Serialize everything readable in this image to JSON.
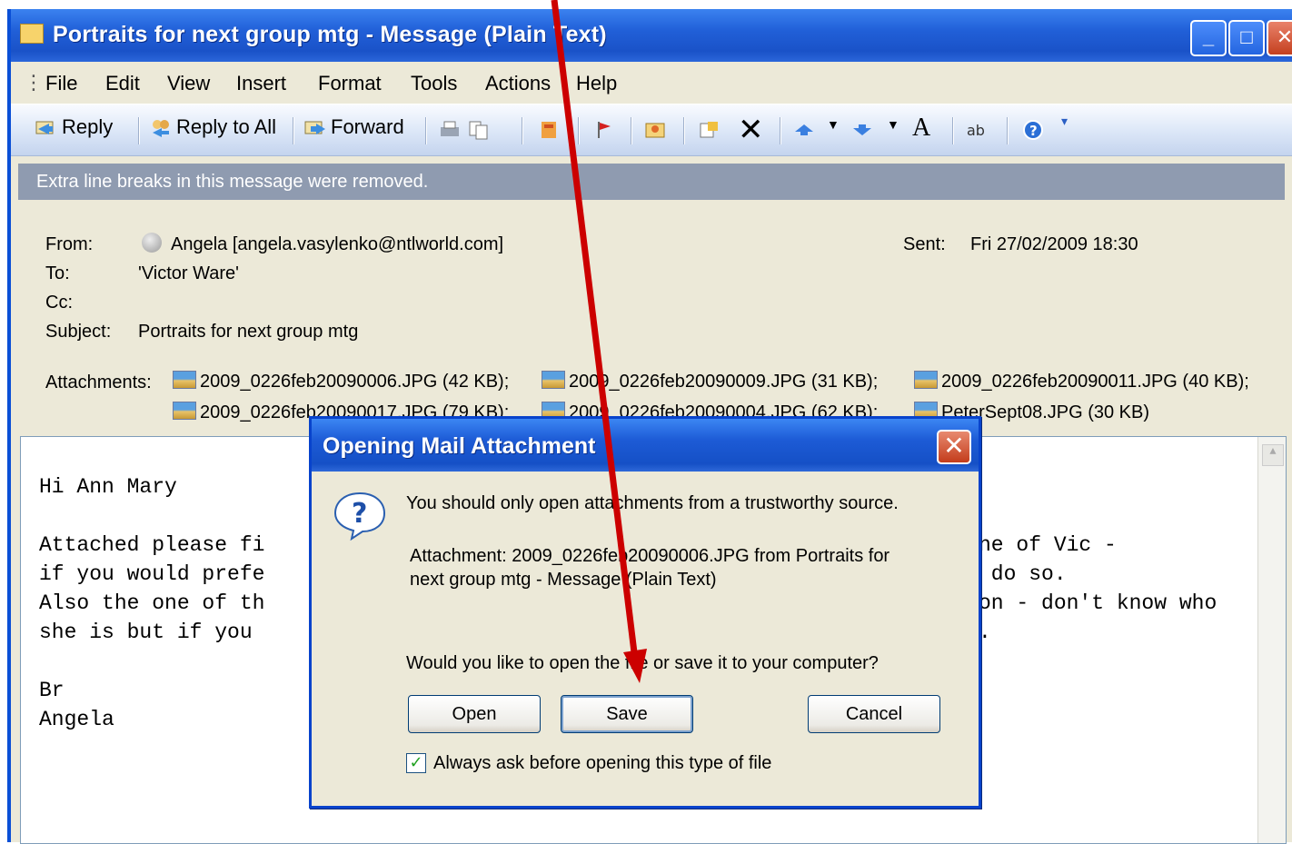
{
  "window": {
    "title": "Portraits for next group mtg - Message (Plain Text)",
    "controls": {
      "minimize": "_",
      "maximize": "□",
      "close": "✕"
    }
  },
  "menu": [
    "File",
    "Edit",
    "View",
    "Insert",
    "Format",
    "Tools",
    "Actions",
    "Help"
  ],
  "toolbar": {
    "reply": "Reply",
    "reply_all": "Reply to All",
    "forward": "Forward",
    "delete_glyph": "✕",
    "font_glyph": "A"
  },
  "infobar": "Extra line breaks in this message were removed.",
  "header": {
    "from_label": "From:",
    "from_value": "Angela [angela.vasylenko@ntlworld.com]",
    "sent_label": "Sent:",
    "sent_value": "Fri 27/02/2009 18:30",
    "to_label": "To:",
    "to_value": "'Victor Ware'",
    "cc_label": "Cc:",
    "cc_value": "",
    "subject_label": "Subject:",
    "subject_value": "Portraits for next group mtg",
    "attachments_label": "Attachments:",
    "attachments": [
      "2009_0226feb20090006.JPG (42 KB);",
      "2009_0226feb20090009.JPG (31 KB);",
      "2009_0226feb20090011.JPG (40 KB);",
      "2009_0226feb20090017.JPG (79 KB);",
      "2009_0226feb20090004.JPG (62 KB);",
      "PeterSept08.JPG (30 KB)"
    ]
  },
  "body": {
    "lines": [
      "Hi Ann Mary",
      "",
      "Attached please fi",
      "if you would prefe",
      "Also the one of th",
      "she is but if you",
      "",
      "Br",
      "Angela"
    ],
    "right_fragments": [
      "ne of Vic -",
      " do so.",
      "on - don't know who",
      "."
    ]
  },
  "dialog": {
    "title": "Opening Mail Attachment",
    "close": "✕",
    "warning": "You should only open attachments from a trustworthy source.",
    "attachment_line1": "Attachment: 2009_0226feb20090006.JPG from Portraits for",
    "attachment_line2": "next group mtg - Message (Plain Text)",
    "question": "Would you like to open the file or save it to your computer?",
    "open_button": "Open",
    "save_button": "Save",
    "cancel_button": "Cancel",
    "checkbox_label": "Always ask before opening this type of file",
    "checkbox_checked": true
  },
  "colors": {
    "title_blue": "#2160d8",
    "annotation_arrow": "#cc0000"
  }
}
